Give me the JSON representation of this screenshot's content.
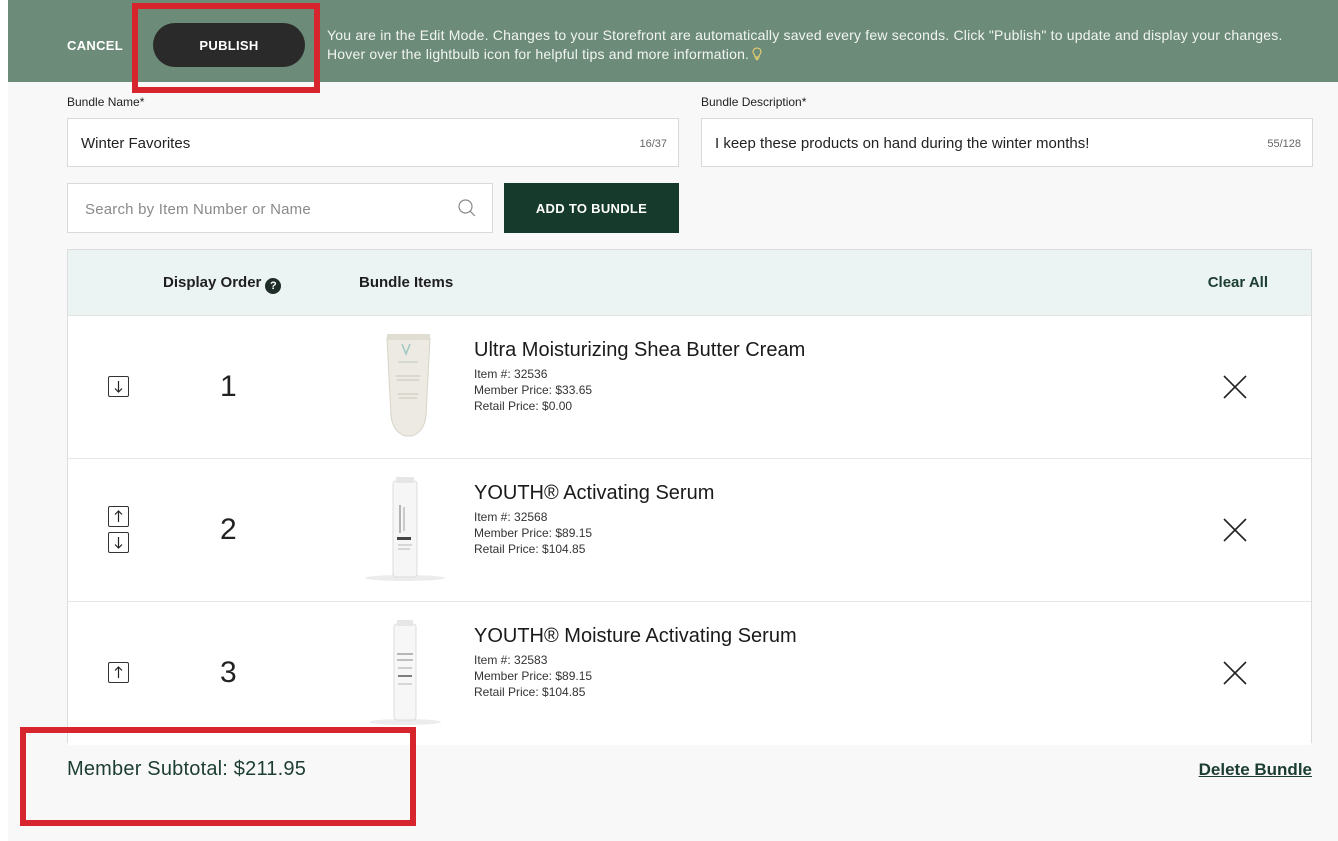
{
  "topbar": {
    "cancel_label": "CANCEL",
    "publish_label": "PUBLISH",
    "message": "You are in the Edit Mode. Changes to your Storefront are automatically saved every few seconds. Click \"Publish\" to update and display your changes. Hover over the lightbulb icon for helpful tips and more information.",
    "bulb_icon": "lightbulb-icon",
    "bar_color": "#6c8b78"
  },
  "form": {
    "bundle_name_label": "Bundle Name*",
    "bundle_name_value": "Winter Favorites",
    "bundle_name_count": "16/37",
    "bundle_description_label": "Bundle Description*",
    "bundle_description_value": "I keep these products on hand during the winter months!",
    "bundle_description_count": "55/128",
    "search_placeholder": "Search by Item Number or Name",
    "search_icon": "search-icon",
    "add_button_label": "ADD TO BUNDLE",
    "add_button_color": "#163a2c"
  },
  "table": {
    "col_display_order": "Display Order",
    "help_glyph": "?",
    "col_bundle_items": "Bundle Items",
    "clear_all_label": "Clear All",
    "header_bg": "#ecf3f3",
    "rows": [
      {
        "order": "1",
        "name": "Ultra Moisturizing Shea Butter Cream",
        "item_number": "Item #: 32536",
        "member_price": "Member Price: $33.65",
        "retail_price": "Retail Price: $0.00",
        "move_up": false,
        "move_down": true
      },
      {
        "order": "2",
        "name": "YOUTH® Activating Serum",
        "item_number": "Item #: 32568",
        "member_price": "Member Price: $89.15",
        "retail_price": "Retail Price: $104.85",
        "move_up": true,
        "move_down": true
      },
      {
        "order": "3",
        "name": "YOUTH® Moisture Activating Serum",
        "item_number": "Item #: 32583",
        "member_price": "Member Price: $89.15",
        "retail_price": "Retail Price: $104.85",
        "move_up": true,
        "move_down": false
      }
    ]
  },
  "footer": {
    "subtotal": "Member Subtotal: $211.95",
    "delete_label": "Delete Bundle"
  },
  "annotations": {
    "highlight_color": "#d6252d"
  }
}
